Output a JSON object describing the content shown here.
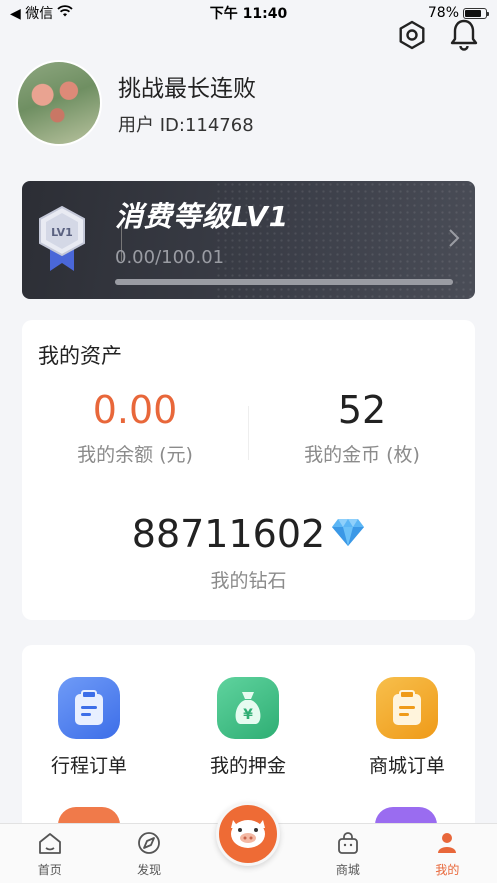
{
  "status_bar": {
    "back_label": "◀ 微信",
    "time": "下午 11:40",
    "battery_percent": "78%",
    "battery_level": 0.78
  },
  "profile": {
    "nickname": "挑战最长连败",
    "user_id": "用户 ID:114768"
  },
  "level": {
    "badge_text": "LV1",
    "title": "消费等级LV1",
    "progress_text": "0.00/100.01",
    "progress_fraction": 0.0
  },
  "assets": {
    "title": "我的资产",
    "balance_value": "0.00",
    "balance_label": "我的余额 (元)",
    "coins_value": "52",
    "coins_label": "我的金币 (枚)",
    "diamonds_value": "88711602",
    "diamonds_label": "我的钻石"
  },
  "menu": {
    "items": [
      {
        "label": "行程订单",
        "icon": "clipboard-icon",
        "color": "#4a7cf0"
      },
      {
        "label": "我的押金",
        "icon": "money-bag-icon",
        "color": "#3fbf86"
      },
      {
        "label": "商城订单",
        "icon": "clipboard-icon",
        "color": "#f2a227"
      }
    ]
  },
  "tabbar": {
    "tabs": [
      {
        "label": "首页",
        "icon": "home-icon"
      },
      {
        "label": "发现",
        "icon": "compass-icon"
      },
      {
        "label": "商城",
        "icon": "shopping-bag-icon"
      },
      {
        "label": "我的",
        "icon": "user-icon"
      }
    ],
    "active_color": "#e8673a",
    "center_icon": "pig-icon"
  },
  "colors": {
    "accent_orange": "#e8673a",
    "balance_color": "#e8673a",
    "diamond_color": "#4aa3f0"
  }
}
